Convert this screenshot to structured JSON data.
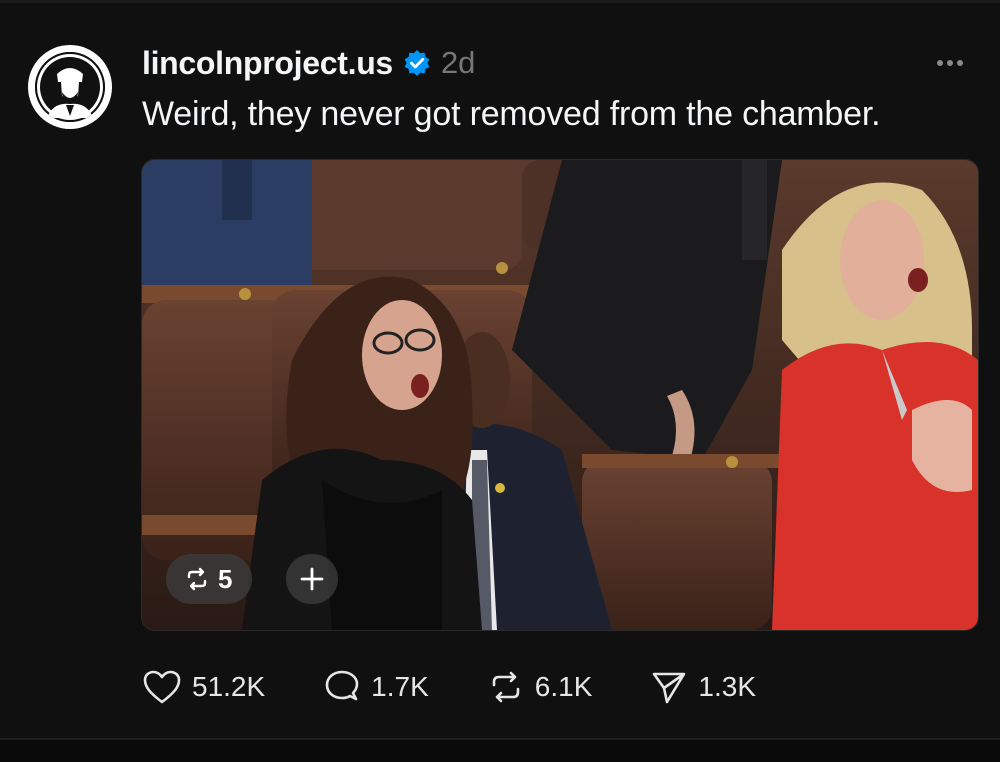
{
  "post": {
    "username": "lincolnproject.us",
    "timestamp": "2d",
    "caption": "Weird, they never got removed from the chamber.",
    "avatar_icon": "lincoln-portrait-icon",
    "verified_icon": "verified-badge-icon",
    "more_icon": "more-options-icon"
  },
  "media": {
    "repost_count": "5",
    "repost_icon": "repost-icon",
    "add_icon": "plus-icon"
  },
  "actions": {
    "likes": "51.2K",
    "replies": "1.7K",
    "reposts": "6.1K",
    "shares": "1.3K"
  },
  "colors": {
    "background": "#101010",
    "text": "#f3f5f7",
    "muted": "#777777",
    "verified": "#0095f6"
  }
}
